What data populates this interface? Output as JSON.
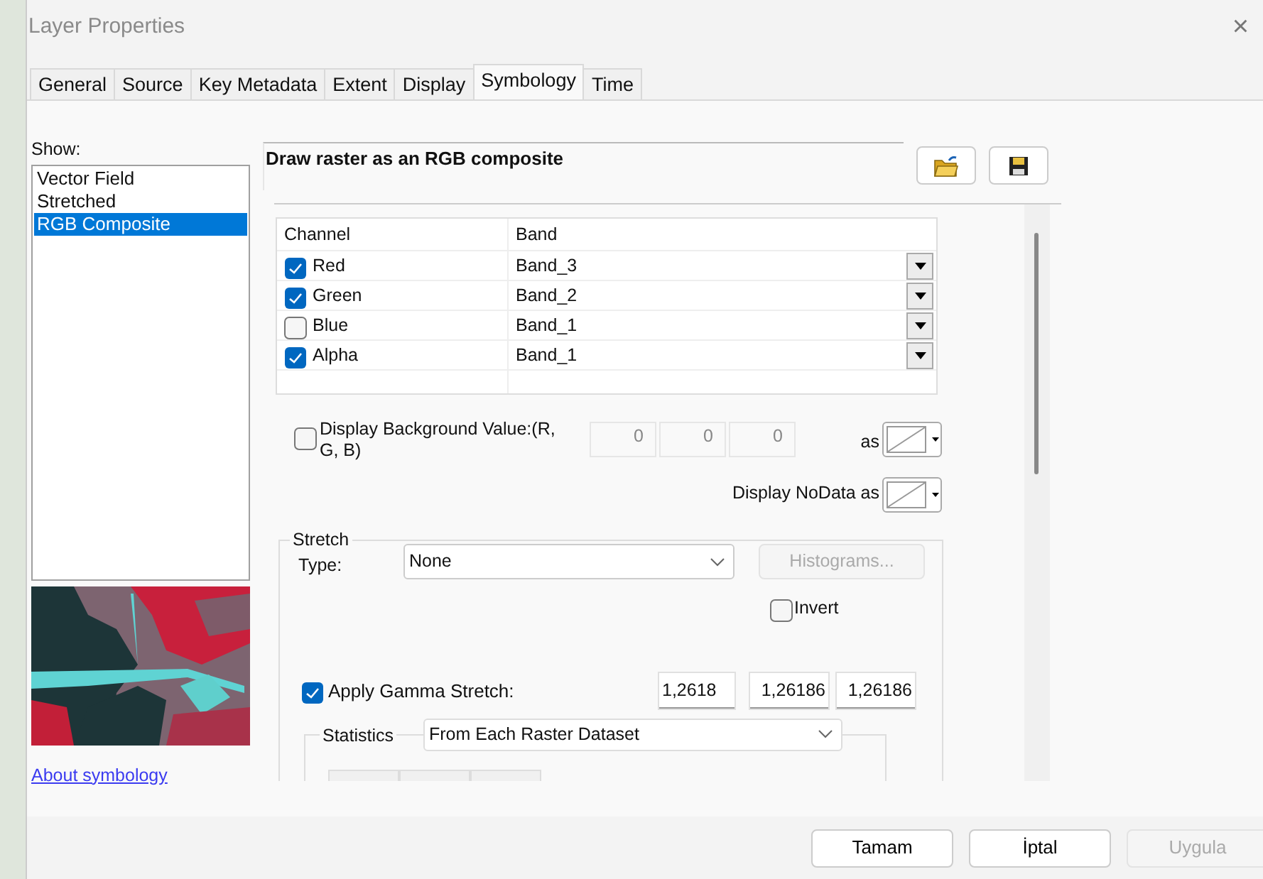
{
  "window": {
    "title": "Layer Properties",
    "close": "×"
  },
  "tabs": [
    {
      "label": "General",
      "selected": false
    },
    {
      "label": "Source",
      "selected": false
    },
    {
      "label": "Key Metadata",
      "selected": false
    },
    {
      "label": "Extent",
      "selected": false
    },
    {
      "label": "Display",
      "selected": false
    },
    {
      "label": "Symbology",
      "selected": true
    },
    {
      "label": "Time",
      "selected": false
    }
  ],
  "show": {
    "label": "Show:",
    "items": [
      {
        "label": "Vector Field",
        "selected": false
      },
      {
        "label": "Stretched",
        "selected": false
      },
      {
        "label": "RGB Composite",
        "selected": true
      }
    ],
    "link": "About symbology"
  },
  "description": "Draw raster as an RGB composite",
  "channels": {
    "columns": [
      "Channel",
      "Band"
    ],
    "rows": [
      {
        "channel": "Red",
        "checked": true,
        "band": "Band_3"
      },
      {
        "channel": "Green",
        "checked": true,
        "band": "Band_2"
      },
      {
        "channel": "Blue",
        "checked": false,
        "band": "Band_1"
      },
      {
        "channel": "Alpha",
        "checked": true,
        "band": "Band_1"
      }
    ]
  },
  "background_value": {
    "label": "Display Background Value:(R, G, B)",
    "checked": false,
    "values": [
      "0",
      "0",
      "0"
    ],
    "as_label": "as"
  },
  "nodata": {
    "label": "Display NoData as"
  },
  "stretch": {
    "title": "Stretch",
    "type_label": "Type:",
    "type": "None",
    "histograms": {
      "label": "Histograms...",
      "disabled": true
    },
    "invert": {
      "label": "Invert",
      "checked": false
    }
  },
  "gamma": {
    "label": "Apply Gamma Stretch:",
    "checked": true,
    "values": [
      "1,2618",
      "1,26186",
      "1,26186"
    ]
  },
  "statistics": {
    "title": "Statistics",
    "source": "From Each Raster Dataset"
  },
  "buttons": [
    {
      "label": "Tamam",
      "disabled": false
    },
    {
      "label": "İptal",
      "disabled": false
    },
    {
      "label": "Uygula",
      "disabled": true
    }
  ]
}
